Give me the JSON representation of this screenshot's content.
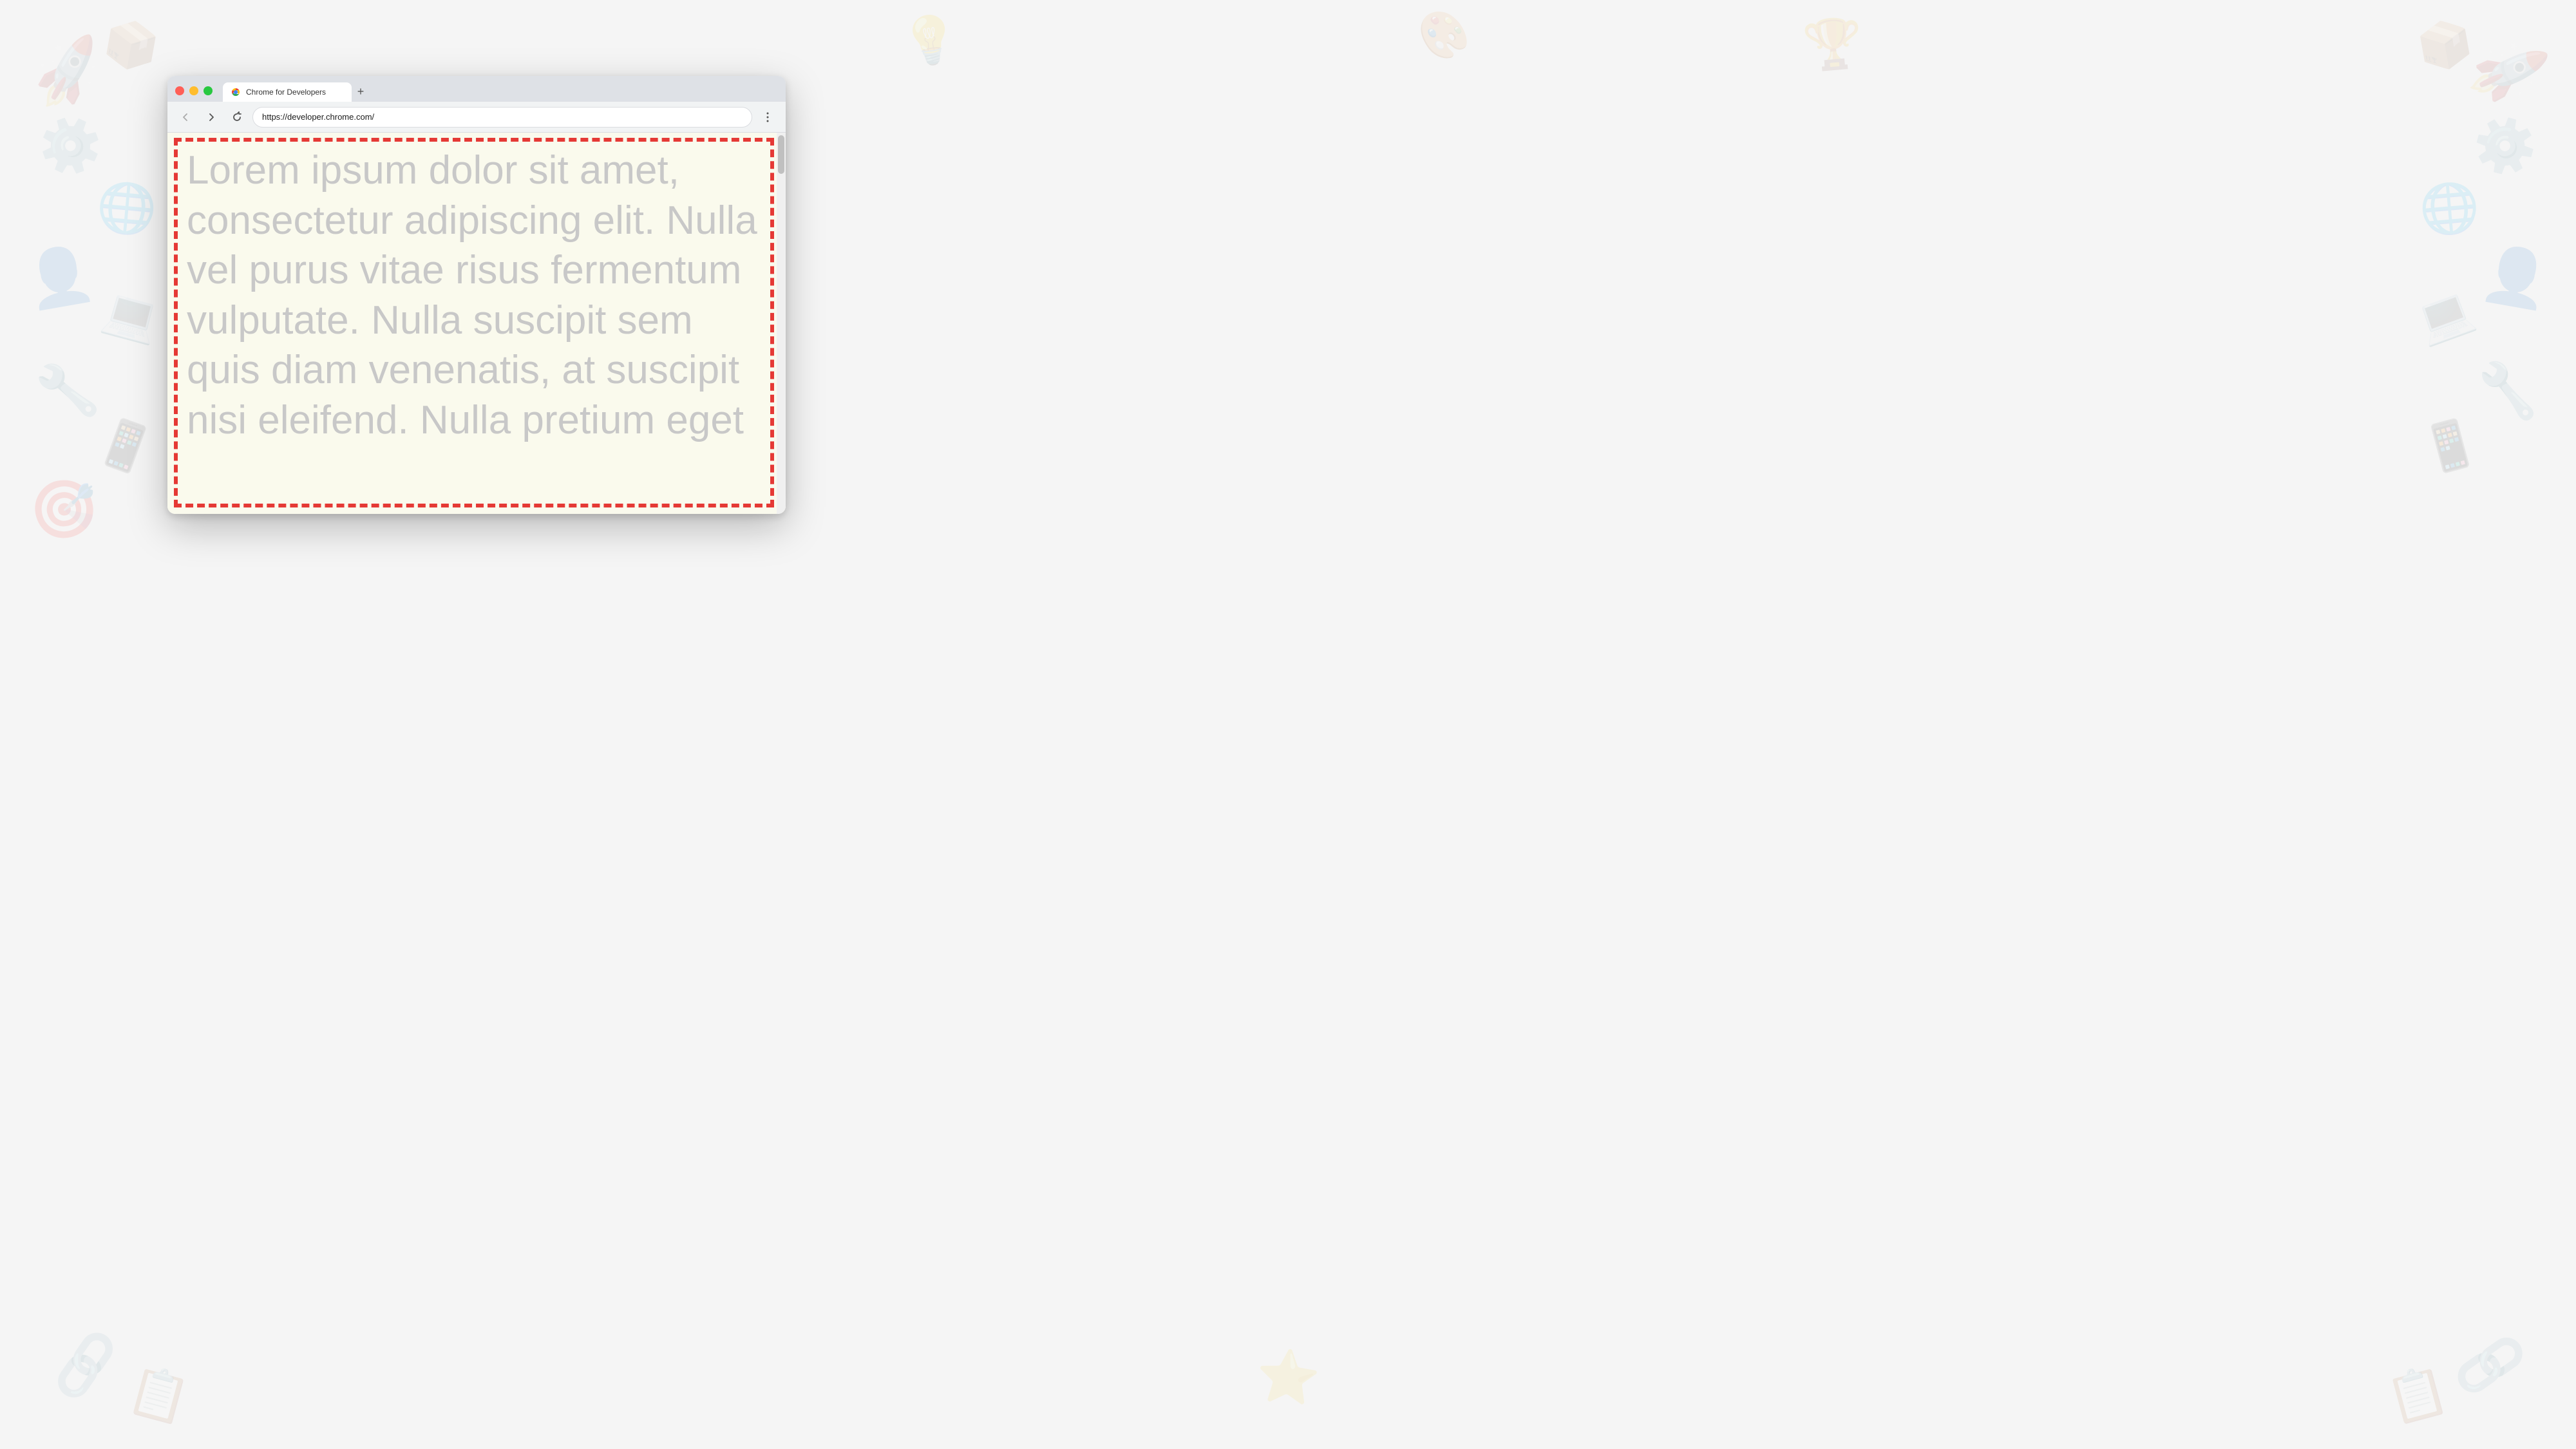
{
  "background": {
    "color": "#f0f0f0"
  },
  "browser": {
    "window": {
      "title": "Chrome for Developers"
    },
    "tab": {
      "label": "Chrome for Developers",
      "favicon_alt": "Chrome logo"
    },
    "new_tab_button": "+",
    "navbar": {
      "back_tooltip": "Back",
      "forward_tooltip": "Forward",
      "reload_tooltip": "Reload",
      "url": "https://developer.chrome.com/",
      "menu_tooltip": "More options"
    },
    "page": {
      "lorem_text": "Lorem ipsum dolor sit amet, consectetur adipiscing elit. Nulla vel purus vitae risus fermentum vulputate. Nulla suscipit sem quis diam venenatis, at suscipit nisi eleifend. Nulla pretium eget",
      "border_color": "#e53935",
      "background_color": "#fafaed"
    }
  }
}
